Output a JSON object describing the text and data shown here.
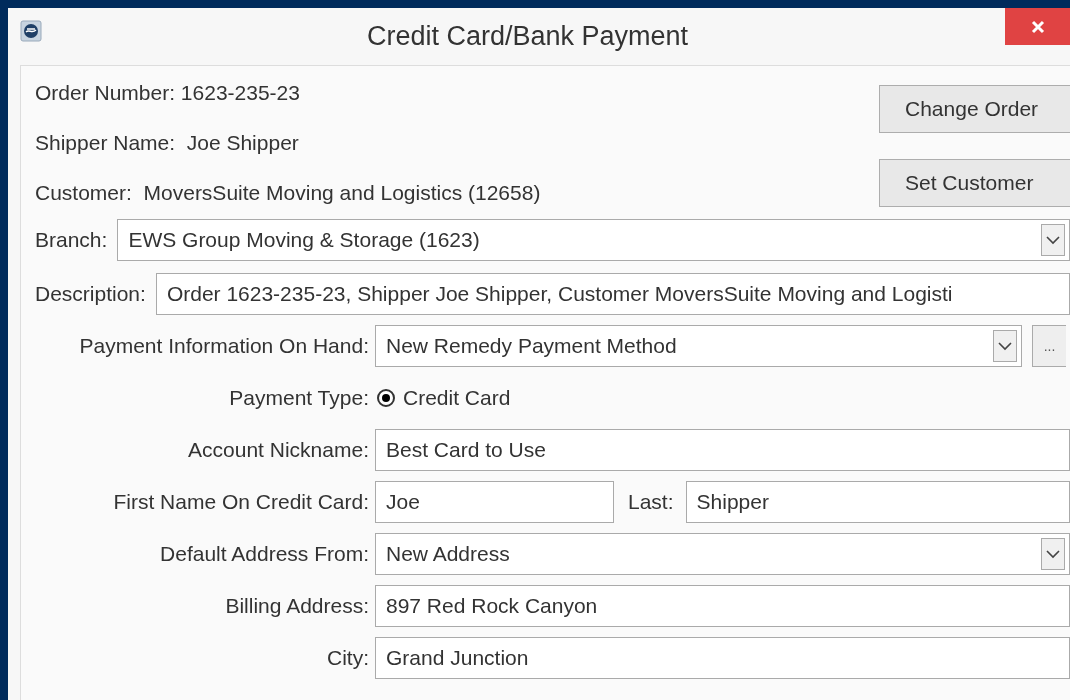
{
  "window": {
    "title": "Credit Card/Bank Payment"
  },
  "info": [
    "Order Number: 1623-235-23",
    "Shipper Name:  Joe Shipper",
    "Customer:  MoversSuite Moving and Logistics (12658)"
  ],
  "buttons": [
    "Change Order",
    "Set Customer"
  ],
  "fields": [
    {
      "kind": "select",
      "label": "Branch:",
      "value": "EWS Group Moving & Storage (1623)"
    },
    {
      "kind": "text",
      "label": "Description:",
      "value": "Order 1623-235-23, Shipper Joe Shipper, Customer MoversSuite Moving and Logisti"
    }
  ],
  "form": [
    {
      "kind": "select-more",
      "label": "Payment Information On Hand:",
      "value": "New Remedy Payment Method",
      "more": "..."
    },
    {
      "kind": "radio",
      "label": "Payment Type:",
      "options": [
        {
          "label": "Credit Card",
          "selected": true
        }
      ]
    },
    {
      "kind": "text",
      "label": "Account Nickname:",
      "value": "Best Card to Use"
    },
    {
      "kind": "name",
      "label": "First Name On Credit Card:",
      "value": "Joe",
      "last_label": "Last:",
      "last_value": "Shipper"
    },
    {
      "kind": "select",
      "label": "Default Address From:",
      "value": "New Address"
    },
    {
      "kind": "text",
      "label": "Billing Address:",
      "value": "897 Red Rock Canyon"
    },
    {
      "kind": "text",
      "label": "City:",
      "value": "Grand Junction"
    }
  ]
}
